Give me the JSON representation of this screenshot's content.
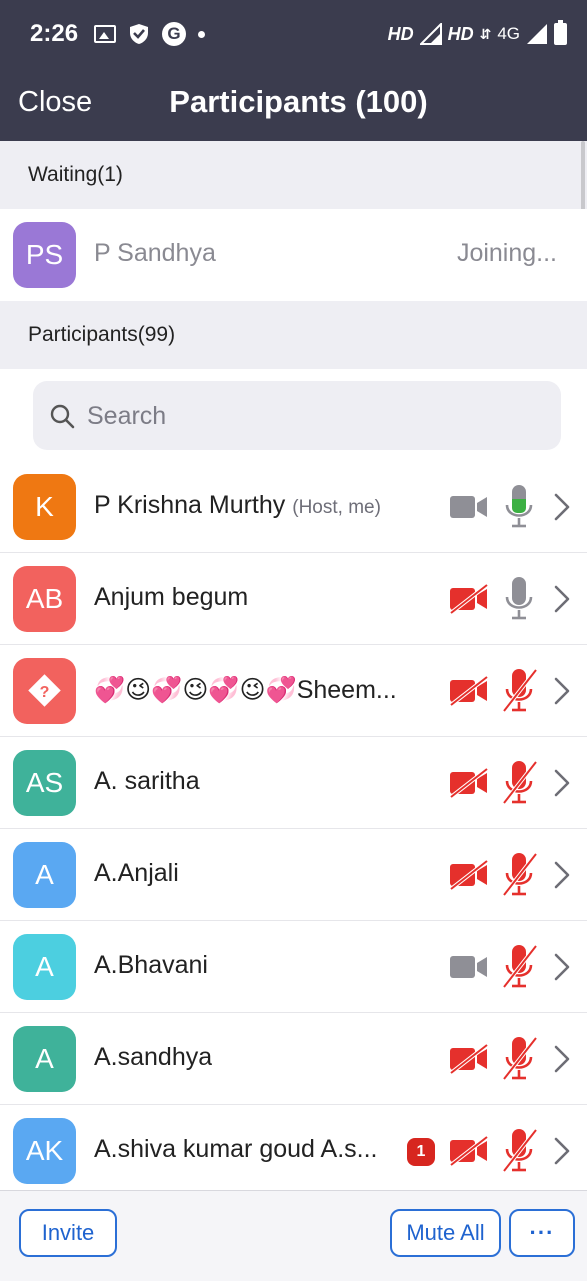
{
  "status_bar": {
    "time": "2:26",
    "network_label_1": "HD",
    "network_label_2": "HD",
    "network_type": "4G",
    "icons": [
      "image-icon",
      "shield-icon",
      "google-icon",
      "dot-icon",
      "signal-icon",
      "battery-icon"
    ]
  },
  "header": {
    "close_label": "Close",
    "title": "Participants (100)"
  },
  "waiting": {
    "heading": "Waiting(1)",
    "items": [
      {
        "initials": "PS",
        "name": "P Sandhya",
        "status": "Joining...",
        "avatar_color": "#9a78d6"
      }
    ]
  },
  "participants": {
    "heading": "Participants(99)",
    "search_placeholder": "Search",
    "items": [
      {
        "initials": "K",
        "name": "P Krishna Murthy",
        "role": "(Host, me)",
        "avatar_color": "#ef7812",
        "video": "off-gray",
        "audio": "on-green",
        "badge": ""
      },
      {
        "initials": "AB",
        "name": "Anjum begum",
        "role": "",
        "avatar_color": "#f2625e",
        "video": "muted-red",
        "audio": "unmuted-gray",
        "badge": ""
      },
      {
        "initials": "?",
        "name": "💞😉💞😉💞😉💞Sheem...",
        "role": "",
        "avatar_color": "#f2625e",
        "video": "muted-red",
        "audio": "muted-red",
        "badge": ""
      },
      {
        "initials": "AS",
        "name": "A. saritha",
        "role": "",
        "avatar_color": "#3fb29a",
        "video": "muted-red",
        "audio": "muted-red",
        "badge": ""
      },
      {
        "initials": "A",
        "name": "A.Anjali",
        "role": "",
        "avatar_color": "#5aa8f2",
        "video": "muted-red",
        "audio": "muted-red",
        "badge": ""
      },
      {
        "initials": "A",
        "name": "A.Bhavani",
        "role": "",
        "avatar_color": "#4ccfe0",
        "video": "off-gray",
        "audio": "muted-red",
        "badge": ""
      },
      {
        "initials": "A",
        "name": "A.sandhya",
        "role": "",
        "avatar_color": "#3fb29a",
        "video": "muted-red",
        "audio": "muted-red",
        "badge": ""
      },
      {
        "initials": "AK",
        "name": "A.shiva kumar goud A.s...",
        "role": "",
        "avatar_color": "#5aa8f2",
        "video": "muted-red",
        "audio": "muted-red",
        "badge": "1"
      }
    ]
  },
  "footer": {
    "invite_label": "Invite",
    "mute_all_label": "Mute All",
    "more_label": "···"
  },
  "colors": {
    "header_bg": "#3b3c4e",
    "accent_blue": "#1f63cf",
    "muted_red": "#e5302c",
    "mic_green": "#3cb043",
    "icon_gray": "#8f8f96"
  }
}
